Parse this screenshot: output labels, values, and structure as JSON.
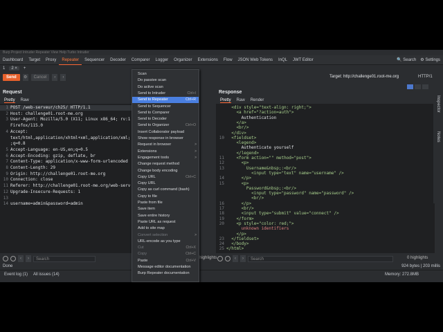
{
  "menubar": "Burp  Project  Intruder  Repeater  View  Help  Turbo Intruder",
  "tabs": [
    "Dashboard",
    "Target",
    "Proxy",
    "Repeater",
    "Sequencer",
    "Decoder",
    "Comparer",
    "Logger",
    "Organizer",
    "Extensions",
    "Flow",
    "JSON Web Tokens",
    "InQL",
    "JWT Editor"
  ],
  "active_tab_index": 3,
  "top_right": {
    "search": "Search",
    "settings": "Settings"
  },
  "subtabs": {
    "tab1": "1",
    "tab2": "2",
    "add": "+"
  },
  "toolbar": {
    "send": "Send",
    "cancel": "Cancel",
    "target": "Target: http://challenge01.root-me.org",
    "http_version": "HTTP/1"
  },
  "request": {
    "title": "Request",
    "tabs": [
      "Pretty",
      "Raw"
    ],
    "lines": [
      {
        "n": "1",
        "t": "POST /web-serveur/ch25/ HTTP/1.1"
      },
      {
        "n": "2",
        "t": "Host: challenge01.root-me.org"
      },
      {
        "n": "3",
        "t": "User-Agent: Mozilla/5.0 (X11; Linux x86_64; rv:1"
      },
      {
        "n": "",
        "t": "Firefox/115.0"
      },
      {
        "n": "4",
        "t": "Accept:"
      },
      {
        "n": "",
        "t": "text/html,application/xhtml+xml,application/xml;"
      },
      {
        "n": "",
        "t": ";q=0.8"
      },
      {
        "n": "5",
        "t": "Accept-Language: en-US,en;q=0.5"
      },
      {
        "n": "6",
        "t": "Accept-Encoding: gzip, deflate, br"
      },
      {
        "n": "7",
        "t": "Content-Type: application/x-www-form-urlencoded"
      },
      {
        "n": "8",
        "t": "Content-Length: 29"
      },
      {
        "n": "9",
        "t": "Origin: http://challenge01.root-me.org"
      },
      {
        "n": "10",
        "t": "Connection: close"
      },
      {
        "n": "11",
        "t": "Referer: http://challenge01.root-me.org/web-serv"
      },
      {
        "n": "12",
        "t": "Upgrade-Insecure-Requests: 1"
      },
      {
        "n": "13",
        "t": ""
      },
      {
        "n": "14",
        "t": "username=admin&password=admin"
      }
    ],
    "search_placeholder": "Search",
    "highlights": "highlights"
  },
  "response": {
    "title": "Response",
    "tabs": [
      "Pretty",
      "Raw",
      "Render"
    ],
    "lines": [
      {
        "n": "",
        "t": "  <div style=\"text-align: right;\">"
      },
      {
        "n": "",
        "t": "    <a href=\"?action=auth\">"
      },
      {
        "n": "",
        "t": "      Authentication"
      },
      {
        "n": "",
        "t": "    </a>"
      },
      {
        "n": "",
        "t": "    <br/>"
      },
      {
        "n": "",
        "t": "  </div>"
      },
      {
        "n": "10",
        "t": "  <fieldset>"
      },
      {
        "n": "",
        "t": "    <legend>"
      },
      {
        "n": "",
        "t": "      Authenticate yourself"
      },
      {
        "n": "",
        "t": "    </legend>"
      },
      {
        "n": "11",
        "t": "    <form action=\"\" method=\"post\">"
      },
      {
        "n": "12",
        "t": "      <p>"
      },
      {
        "n": "13",
        "t": "        Username&nbsp;:<br/>"
      },
      {
        "n": "",
        "t": "          <input type=\"text\" name=\"username\" />"
      },
      {
        "n": "14",
        "t": "      </p>"
      },
      {
        "n": "15",
        "t": "      <p>"
      },
      {
        "n": "",
        "t": "        Password&nbsp;:<br/>"
      },
      {
        "n": "",
        "t": "          <input type=\"password\" name=\"password\" />"
      },
      {
        "n": "",
        "t": "          <br/>"
      },
      {
        "n": "16",
        "t": "      </p>"
      },
      {
        "n": "17",
        "t": "      <br/>"
      },
      {
        "n": "18",
        "t": "      <input type=\"submit\" value=\"connect\" />"
      },
      {
        "n": "19",
        "t": "    </form>"
      },
      {
        "n": "20",
        "t": "    <p style=\"color: red;\">"
      },
      {
        "n": "",
        "t": "      unknown identifiers"
      },
      {
        "n": "",
        "t": "    </p>"
      },
      {
        "n": "23",
        "t": "  </fieldset>"
      },
      {
        "n": "24",
        "t": "  </body>"
      },
      {
        "n": "25",
        "t": "</html>"
      }
    ],
    "search_placeholder": "Search",
    "highlights": "0 highlights"
  },
  "status": {
    "left": "Done",
    "right": "924 bytes | 203 millis"
  },
  "footer": {
    "event_log": "Event log (1)",
    "all_issues": "All issues (14)",
    "memory": "Memory: 272.8MB"
  },
  "sidebar": [
    "Inspector",
    "Notes"
  ],
  "context_menu": [
    {
      "label": "Scan",
      "sc": "",
      "disabled": false
    },
    {
      "label": "Do passive scan",
      "sc": "",
      "disabled": false
    },
    {
      "label": "Do active scan",
      "sc": "",
      "disabled": false
    },
    {
      "label": "Send to Intruder",
      "sc": "Ctrl+I",
      "disabled": false
    },
    {
      "label": "Send to Repeater",
      "sc": "Ctrl+R",
      "disabled": false,
      "selected": true
    },
    {
      "label": "Send to Sequencer",
      "sc": "",
      "disabled": false
    },
    {
      "label": "Send to Comparer",
      "sc": "",
      "disabled": false
    },
    {
      "label": "Send to Decoder",
      "sc": "",
      "disabled": false
    },
    {
      "label": "Send to Organizer",
      "sc": "Ctrl+O",
      "disabled": false
    },
    {
      "label": "Insert Collaborator payload",
      "sc": "",
      "disabled": false
    },
    {
      "label": "Show response in browser",
      "sc": "",
      "disabled": false
    },
    {
      "label": "Request in browser",
      "sc": ">",
      "disabled": false
    },
    {
      "label": "Extensions",
      "sc": ">",
      "disabled": false
    },
    {
      "label": "Engagement tools",
      "sc": ">",
      "disabled": false
    },
    {
      "label": "Change request method",
      "sc": "",
      "disabled": false
    },
    {
      "label": "Change body encoding",
      "sc": "",
      "disabled": false
    },
    {
      "label": "Copy URL",
      "sc": "Ctrl+C",
      "disabled": false
    },
    {
      "label": "Copy URL",
      "sc": "",
      "disabled": false
    },
    {
      "label": "Copy as curl command (bash)",
      "sc": "",
      "disabled": false
    },
    {
      "label": "Copy to file",
      "sc": "",
      "disabled": false
    },
    {
      "label": "Paste from file",
      "sc": "",
      "disabled": false
    },
    {
      "label": "Save item",
      "sc": "",
      "disabled": false
    },
    {
      "label": "Save entire history",
      "sc": "",
      "disabled": false
    },
    {
      "label": "Paste URL as request",
      "sc": "",
      "disabled": false
    },
    {
      "label": "Add to site map",
      "sc": "",
      "disabled": false
    },
    {
      "label": "Convert selection",
      "sc": ">",
      "disabled": true
    },
    {
      "label": "URL-encode as you type",
      "sc": "",
      "disabled": false
    },
    {
      "label": "Cut",
      "sc": "Ctrl+X",
      "disabled": true
    },
    {
      "label": "Copy",
      "sc": "Ctrl+C",
      "disabled": true
    },
    {
      "label": "Paste",
      "sc": "Ctrl+V",
      "disabled": false
    },
    {
      "label": "Message editor documentation",
      "sc": "",
      "disabled": false
    },
    {
      "label": "Burp Repeater documentation",
      "sc": "",
      "disabled": false
    }
  ]
}
